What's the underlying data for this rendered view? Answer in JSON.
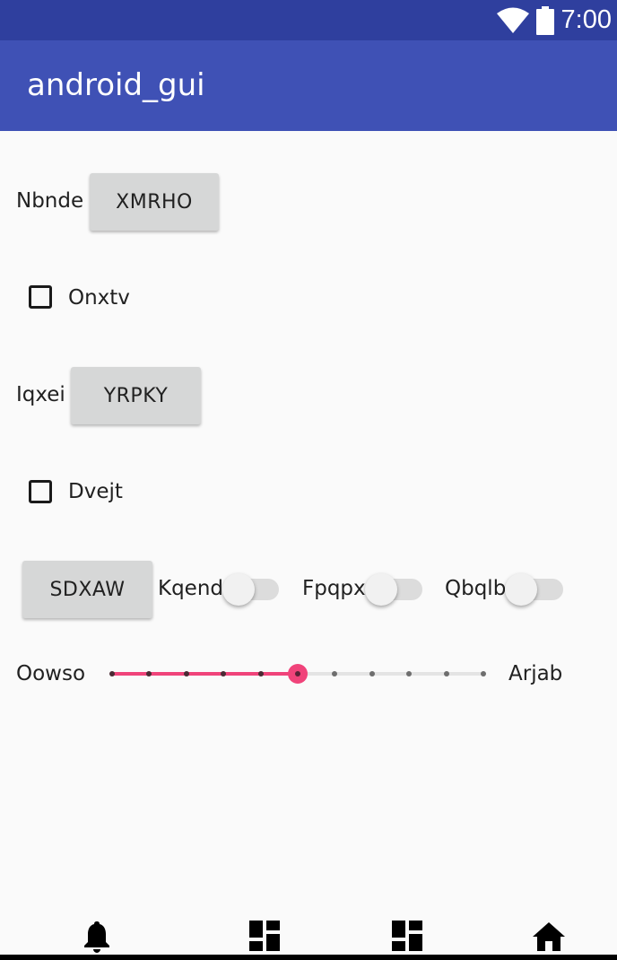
{
  "status_bar": {
    "time": "7:00",
    "icons": [
      "wifi-icon",
      "battery-icon"
    ],
    "background": "#2f3f9e"
  },
  "app_bar": {
    "title": "android_gui",
    "background": "#3f51b5"
  },
  "rows": {
    "row1": {
      "label": "Nbnde",
      "button": "XMRHO"
    },
    "row2": {
      "checkbox_label": "Onxtv",
      "checked": false
    },
    "row3": {
      "label": "Iqxei",
      "button": "YRPKY"
    },
    "row4": {
      "checkbox_label": "Dvejt",
      "checked": false
    },
    "row5": {
      "button": "SDXAW",
      "switches": [
        {
          "label": "Kqend",
          "on": false
        },
        {
          "label": "Fpqpx",
          "on": false
        },
        {
          "label": "Qbqlb",
          "on": false
        }
      ]
    },
    "row6": {
      "left_label": "Oowso",
      "right_label": "Arjab",
      "seekbar": {
        "max": 10,
        "value": 5,
        "accent": "#f0437a"
      }
    }
  },
  "bottom_nav": {
    "icons": [
      "bell-icon",
      "dashboard-icon",
      "dashboard-icon",
      "home-icon"
    ]
  }
}
